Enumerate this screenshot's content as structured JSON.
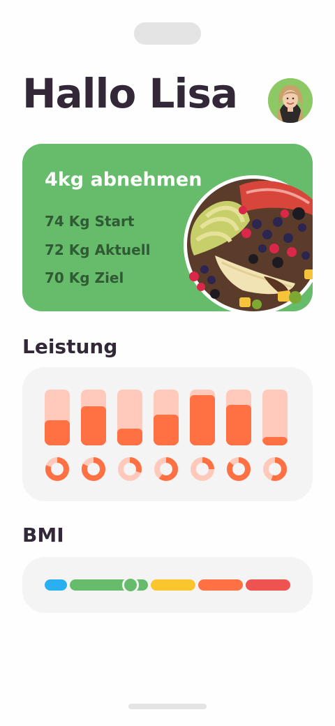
{
  "header": {
    "greeting": "Hallo Lisa"
  },
  "goal": {
    "title": "4kg abnehmen",
    "start": "74 Kg Start",
    "current": "72 Kg Aktuell",
    "target": "70 Kg Ziel"
  },
  "performance": {
    "title": "Leistung",
    "bars": [
      0.45,
      0.7,
      0.3,
      0.55,
      0.9,
      0.73,
      0.15
    ],
    "rings": [
      0.8,
      0.82,
      0.3,
      0.6,
      0.25,
      0.85,
      0.55
    ]
  },
  "bmi": {
    "title": "BMI",
    "segments": [
      {
        "name": "underweight",
        "color": "#2ab0f0"
      },
      {
        "name": "normal",
        "color": "#66bc6a"
      },
      {
        "name": "overweight",
        "color": "#fbc52d"
      },
      {
        "name": "obese",
        "color": "#ff7043"
      },
      {
        "name": "severely-obese",
        "color": "#ef5350"
      }
    ],
    "marker_segment": "normal",
    "marker_position_in_segment": 0.78
  },
  "colors": {
    "text_dark": "#332838",
    "green": "#66bc6a",
    "orange": "#ff7043",
    "orange_light": "#ffcabc",
    "card_gray": "#f4f4f4"
  }
}
